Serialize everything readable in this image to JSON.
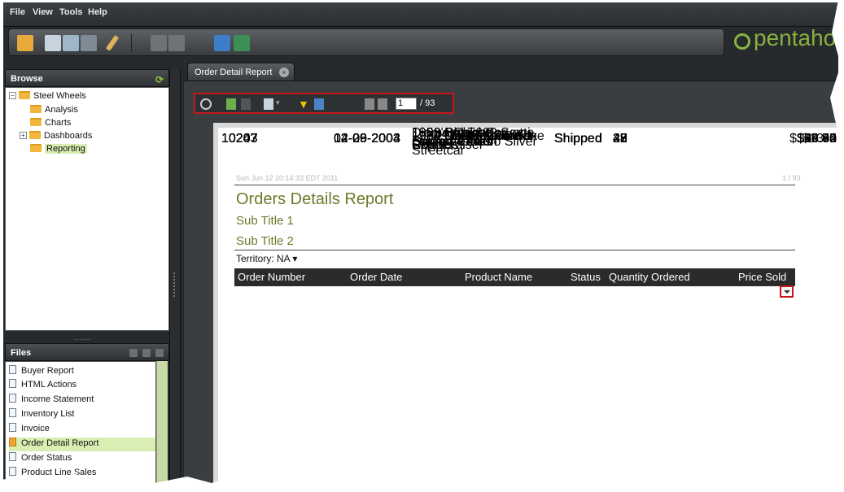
{
  "menu": {
    "items": [
      "File",
      "View",
      "Tools",
      "Help"
    ]
  },
  "brand": {
    "logo_text": "pentaho",
    "accent": "#87b33f"
  },
  "toolbar": {
    "icons": [
      "open-folder-icon",
      "new-report-icon",
      "new-analysis-icon",
      "new-dashboard-icon",
      "edit-icon",
      "save-icon",
      "save-as-icon",
      "workspace-icon",
      "admin-icon"
    ]
  },
  "browse": {
    "title": "Browse",
    "tree": [
      {
        "label": "Steel Wheels",
        "expander": "⊟",
        "level": 0
      },
      {
        "label": "Analysis",
        "level": 1
      },
      {
        "label": "Charts",
        "level": 1
      },
      {
        "label": "Dashboards",
        "expander": "⊞",
        "level": 1
      },
      {
        "label": "Reporting",
        "level": 1,
        "selected": true
      }
    ]
  },
  "files": {
    "title": "Files",
    "splitter_label": "......",
    "items": [
      {
        "label": "Buyer Report"
      },
      {
        "label": "HTML Actions"
      },
      {
        "label": "Income Statement"
      },
      {
        "label": "Inventory List"
      },
      {
        "label": "Invoice"
      },
      {
        "label": "Order Detail Report",
        "selected": true
      },
      {
        "label": "Order Status"
      },
      {
        "label": "Product Line Sales"
      }
    ]
  },
  "tab": {
    "label": "Order Detail Report"
  },
  "report_toolbar": {
    "page_current": "1",
    "page_total": "/ 93"
  },
  "report": {
    "timestamp": "Sun Jun 12 20:14:33 EDT 2011",
    "page_indicator": "1 / 93",
    "title": "Orders Details Report",
    "subtitle1": "Sub Title 1",
    "subtitle2": "Sub Title 2",
    "territory": "Territory: NA ▾",
    "columns": [
      "Order Number",
      "Order Date",
      "Product Name",
      "Status",
      "Quantity Ordered",
      "Price Sold"
    ],
    "rows": [
      [
        "10243",
        "04-26-2004",
        "1932 Model A Ford J-Coupe",
        "Shipped",
        "47",
        "$13"
      ],
      [
        "10243",
        "04-26-2004",
        "1939 Chevrolet Deluxe Coupe",
        "Shipped",
        "33",
        "$29.54"
      ],
      [
        "10207",
        "12-09-2003",
        "1950's Chicago Surface Lines Streetcar",
        "Shipped",
        "45",
        "$56.55"
      ],
      [
        "10207",
        "12-09-2003",
        "Diamond T620 Semi-Skirted Tanker",
        "Shipped",
        "28",
        "$94.92"
      ],
      [
        "10207",
        "12-09-2003",
        "1980s GM Manhattan Express",
        "Shipped",
        "49",
        "$80.90"
      ],
      [
        "10207",
        "12-09-2003",
        "1954 Greyhound Scenicruiser",
        "Shipped",
        "27",
        "$60.06"
      ],
      [
        "10207",
        "12-09-2003",
        "1958 Chevy Corvette Limited Edition",
        "Shipped",
        "42",
        "$29.70"
      ],
      [
        "10207",
        "12-09-2003",
        "1992 Porsche Cayenne Turbo Silver",
        "Shipped",
        "28",
        "$106.45"
      ],
      [
        "10207",
        "12-09-2003",
        "1970 Dodge Coronet",
        "Shipped",
        "49",
        "$46.82"
      ]
    ]
  }
}
